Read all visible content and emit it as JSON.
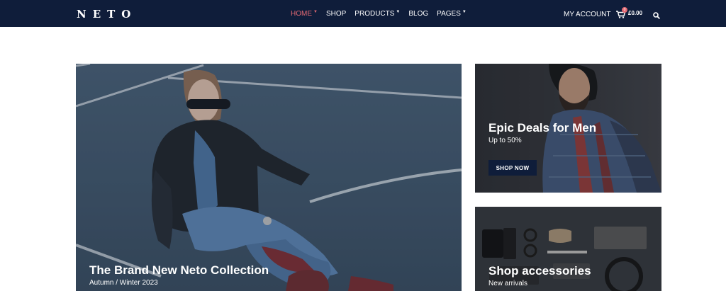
{
  "brand": {
    "logo": "NETO"
  },
  "nav": {
    "items": [
      {
        "label": "HOME",
        "caret": "▼"
      },
      {
        "label": "SHOP",
        "caret": ""
      },
      {
        "label": "PRODUCTS",
        "caret": "▼"
      },
      {
        "label": "BLOG",
        "caret": ""
      },
      {
        "label": "PAGES",
        "caret": "▼"
      }
    ]
  },
  "header": {
    "account_label": "MY ACCOUNT",
    "cart_count": "0",
    "cart_total": "£0.00"
  },
  "hero": {
    "title": "The Brand New Neto Collection",
    "subtitle": "Autumn / Winter 2023"
  },
  "promos": {
    "men": {
      "title": "Epic Deals for Men",
      "subtitle": "Up to 50%",
      "button": "SHOP NOW"
    },
    "accessories": {
      "title": "Shop accessories",
      "subtitle": "New arrivals"
    }
  },
  "colors": {
    "header_bg": "#0f1d3a",
    "accent": "#e46a73"
  },
  "icons": [
    "cart-icon",
    "search-icon",
    "chevron-down-icon"
  ]
}
